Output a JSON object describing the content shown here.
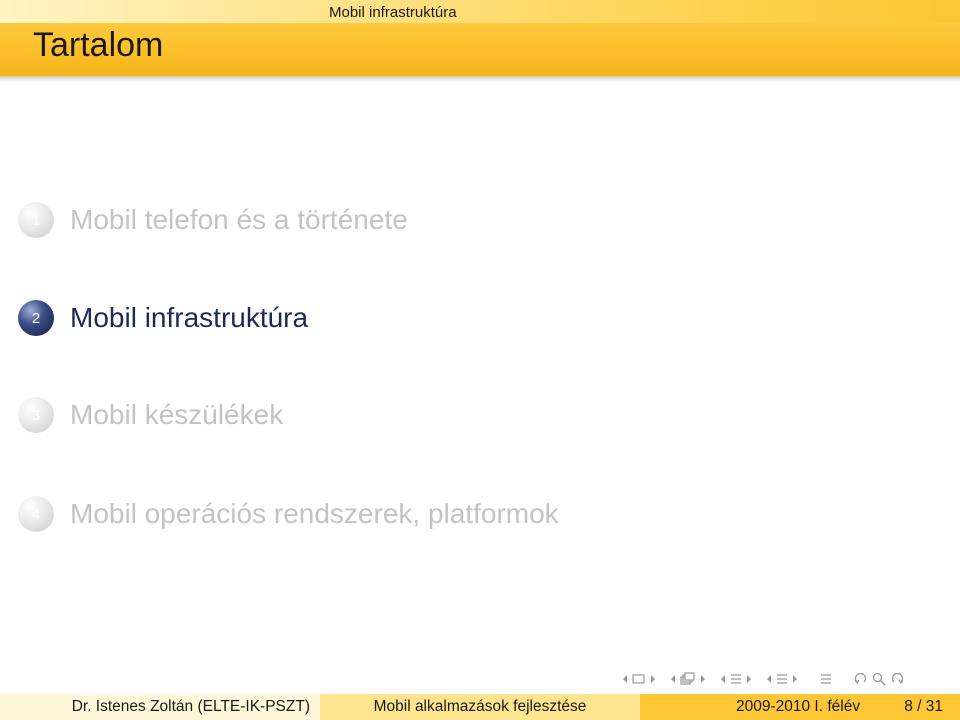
{
  "header": {
    "section": "Mobil infrastruktúra",
    "frame_title": "Tartalom"
  },
  "toc": [
    {
      "number": "1",
      "label": "Mobil telefon és a története",
      "state": "dimmed"
    },
    {
      "number": "2",
      "label": "Mobil infrastruktúra",
      "state": "active"
    },
    {
      "number": "3",
      "label": "Mobil készülékek",
      "state": "dimmed"
    },
    {
      "number": "4",
      "label": "Mobil operációs rendszerek, platformok",
      "state": "dimmed"
    }
  ],
  "footer": {
    "author": "Dr. Istenes Zoltán  (ELTE-IK-PSZT)",
    "title": "Mobil alkalmazások fejlesztése",
    "date": "2009-2010 I. félév",
    "page": "8 / 31"
  },
  "nav_icons": [
    "frame-prev-icon",
    "frame-icon",
    "frame-next-icon",
    "subsection-prev-icon",
    "subsection-icon",
    "subsection-next-icon",
    "section-prev-icon",
    "section-icon",
    "section-next-icon",
    "document-prev-icon",
    "document-icon",
    "document-next-icon",
    "toc-icon",
    "back-icon",
    "search-icon",
    "forward-icon"
  ],
  "colors": {
    "header_yellow": "#fcc22d",
    "active_ball": "#2a3a70",
    "active_text": "#1c2a5a",
    "dimmed_text": "#c3c3c3"
  }
}
